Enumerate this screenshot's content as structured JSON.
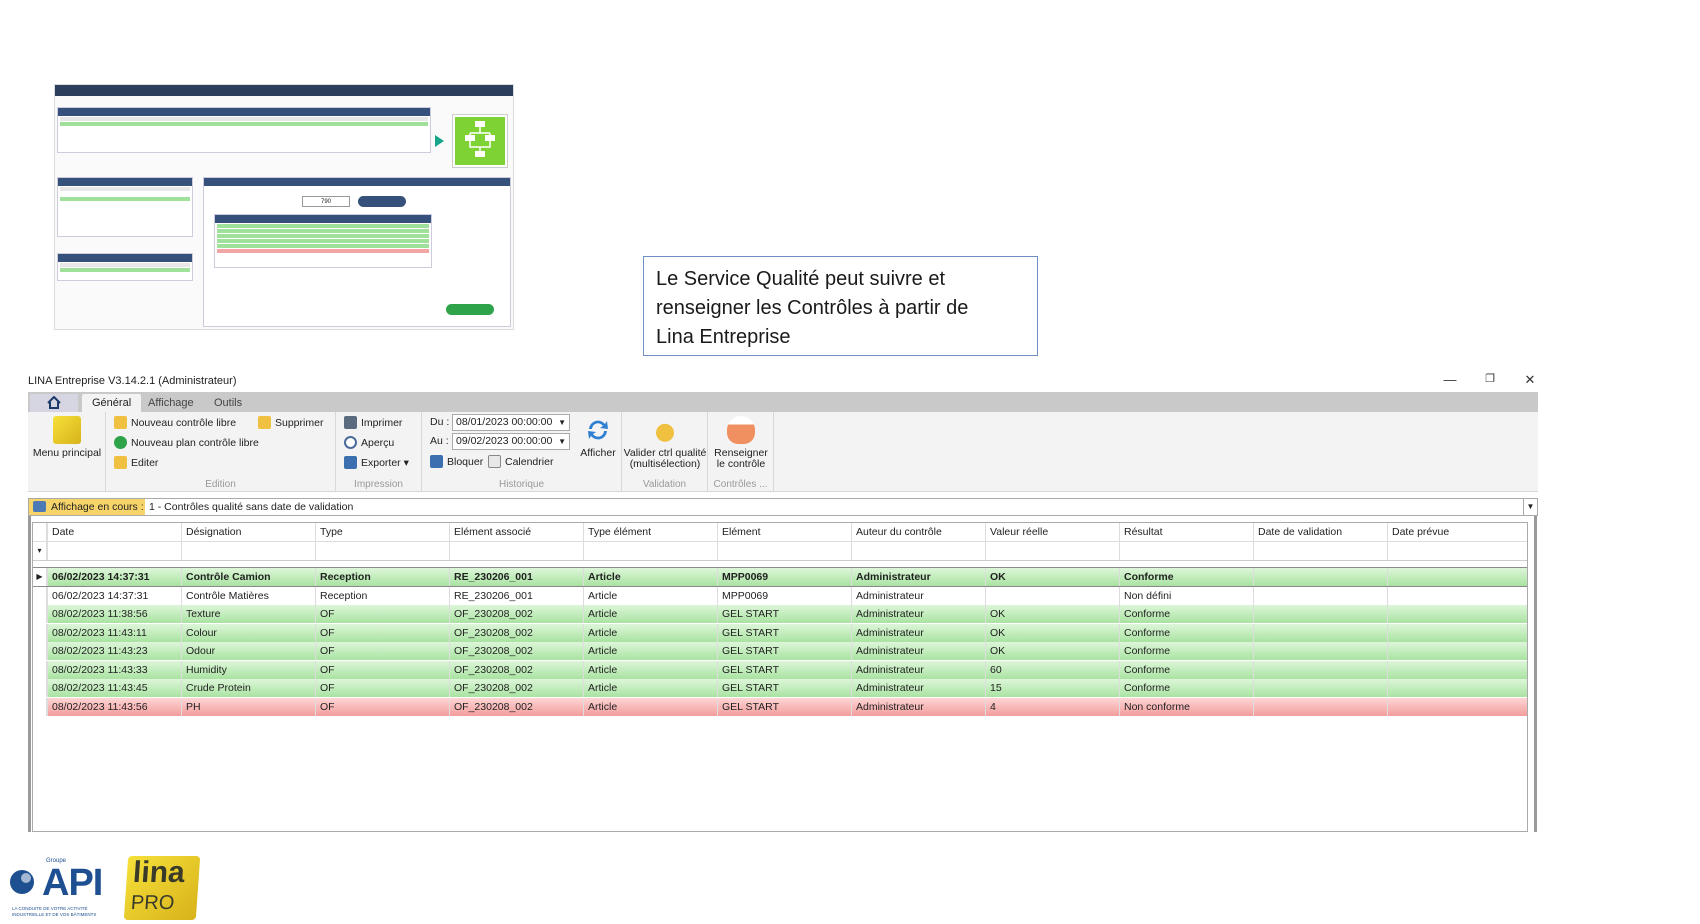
{
  "callout": {
    "line1": "Le Service Qualité peut suivre et",
    "line2": "renseigner les Contrôles à partir de",
    "line3": "Lina Entreprise"
  },
  "window": {
    "title": "LINA Entreprise  V3.14.2.1  (Administrateur)",
    "minimize": "—",
    "restore": "❐",
    "close": "✕"
  },
  "tabs": [
    {
      "label": "Général",
      "active": true
    },
    {
      "label": "Affichage",
      "active": false
    },
    {
      "label": "Outils",
      "active": false
    }
  ],
  "ribbon": {
    "menu_principal": "Menu principal",
    "edition": {
      "label": "Edition",
      "nouveau_controle_libre": "Nouveau contrôle libre",
      "nouveau_plan_controle_libre": "Nouveau plan contrôle libre",
      "editer": "Editer",
      "supprimer": "Supprimer"
    },
    "impression": {
      "label": "Impression",
      "imprimer": "Imprimer",
      "apercu": "Aperçu",
      "exporter": "Exporter ▾"
    },
    "historique": {
      "label": "Historique",
      "du_label": "Du :",
      "du_value": "08/01/2023 00:00:00",
      "au_label": "Au :",
      "au_value": "09/02/2023 00:00:00",
      "bloquer": "Bloquer",
      "calendrier": "Calendrier",
      "afficher": "Afficher"
    },
    "validation": {
      "label": "Validation",
      "valider_line1": "Valider ctrl qualité",
      "valider_line2": "(multisélection)"
    },
    "controles": {
      "label": "Contrôles ...",
      "renseigner_line1": "Renseigner",
      "renseigner_line2": "le contrôle"
    }
  },
  "display": {
    "label": "Affichage en cours :",
    "value": "1 - Contrôles qualité sans date de validation"
  },
  "grid": {
    "columns": [
      "Date",
      "Désignation",
      "Type",
      "Elément associé",
      "Type élément",
      "Elément",
      "Auteur du contrôle",
      "Valeur réelle",
      "Résultat",
      "Date de validation",
      "Date prévue"
    ],
    "rows": [
      {
        "cells": [
          "06/02/2023 14:37:31",
          "Contrôle Camion",
          "Reception",
          "RE_230206_001",
          "Article",
          "MPP0069",
          "Administrateur",
          "OK",
          "Conforme",
          "",
          ""
        ],
        "status": "green",
        "selected": true
      },
      {
        "cells": [
          "06/02/2023 14:37:31",
          "Contrôle Matières",
          "Reception",
          "RE_230206_001",
          "Article",
          "MPP0069",
          "Administrateur",
          "",
          "Non défini",
          "",
          ""
        ],
        "status": "none",
        "selected": false
      },
      {
        "cells": [
          "08/02/2023 11:38:56",
          "Texture",
          "OF",
          "OF_230208_002",
          "Article",
          "GEL START",
          "Administrateur",
          "OK",
          "Conforme",
          "",
          ""
        ],
        "status": "green",
        "selected": false
      },
      {
        "cells": [
          "08/02/2023 11:43:11",
          "Colour",
          "OF",
          "OF_230208_002",
          "Article",
          "GEL START",
          "Administrateur",
          "OK",
          "Conforme",
          "",
          ""
        ],
        "status": "green",
        "selected": false
      },
      {
        "cells": [
          "08/02/2023 11:43:23",
          "Odour",
          "OF",
          "OF_230208_002",
          "Article",
          "GEL START",
          "Administrateur",
          "OK",
          "Conforme",
          "",
          ""
        ],
        "status": "green",
        "selected": false
      },
      {
        "cells": [
          "08/02/2023 11:43:33",
          "Humidity",
          "OF",
          "OF_230208_002",
          "Article",
          "GEL START",
          "Administrateur",
          "60",
          "Conforme",
          "",
          ""
        ],
        "status": "green",
        "selected": false
      },
      {
        "cells": [
          "08/02/2023 11:43:45",
          "Crude Protein",
          "OF",
          "OF_230208_002",
          "Article",
          "GEL START",
          "Administrateur",
          "15",
          "Conforme",
          "",
          ""
        ],
        "status": "green",
        "selected": false
      },
      {
        "cells": [
          "08/02/2023 11:43:56",
          "PH",
          "OF",
          "OF_230208_002",
          "Article",
          "GEL START",
          "Administrateur",
          "4",
          "Non conforme",
          "",
          ""
        ],
        "status": "red",
        "selected": false
      }
    ]
  },
  "thumbnail": {
    "quantity_value": "790"
  },
  "logos": {
    "api": "API",
    "api_group": "Groupe",
    "api_tagline": "LA CONDUITE DE VOTRE ACTIVITÉ INDUSTRIELLE ET DE VOS BÂTIMENTS",
    "lina": "lina",
    "pro": "PRO"
  },
  "colors": {
    "row_green": "#a9e3a1",
    "row_red": "#f29c9c",
    "ribbon_bg": "#f3f3f3",
    "display_label_bg": "#f7d46a"
  }
}
